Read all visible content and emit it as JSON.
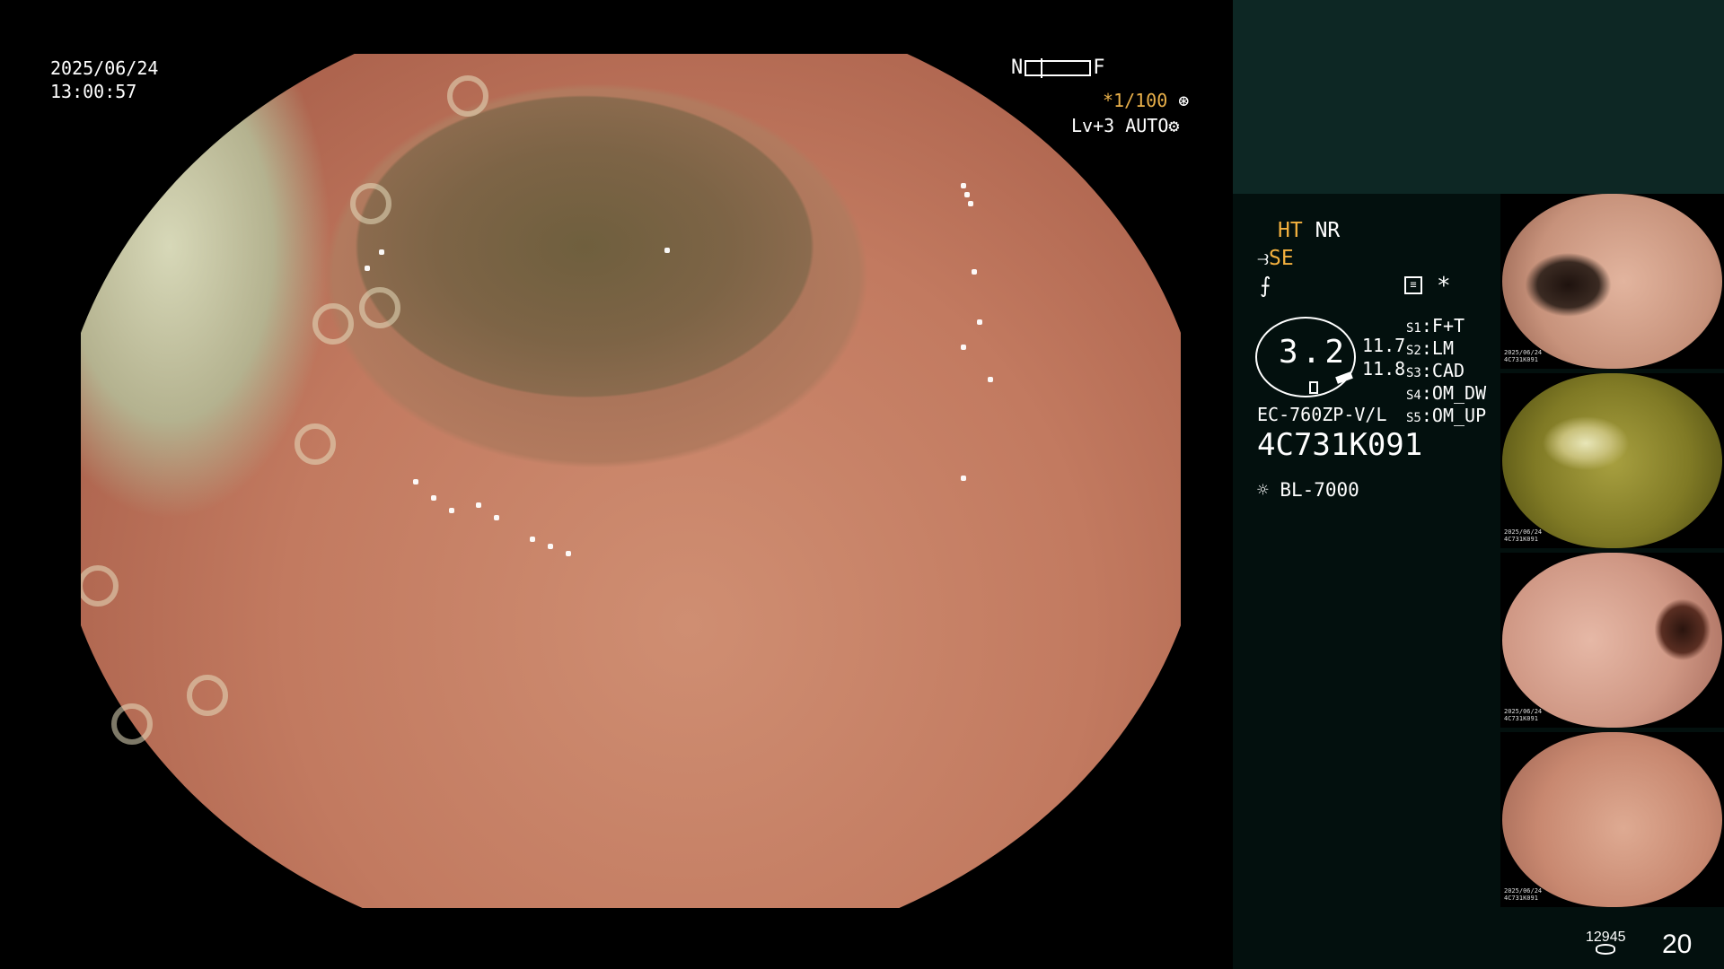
{
  "overlay": {
    "date": "2025/06/24",
    "time": "13:00:57",
    "near_label": "N",
    "far_label": "F",
    "zoom": "*1/100",
    "level": "Lv+3",
    "mode": "AUTO"
  },
  "panel": {
    "ht": "HT",
    "nr": "NR",
    "se": "SE",
    "star": "*",
    "gauge_value": "3.2",
    "value1": "11.7",
    "value2": "11.8",
    "settings": [
      {
        "key": "S1",
        "value": "F+T"
      },
      {
        "key": "S2",
        "value": "LM"
      },
      {
        "key": "S3",
        "value": "CAD"
      },
      {
        "key": "S4",
        "value": "OM_DW"
      },
      {
        "key": "S5",
        "value": "OM_UP"
      }
    ],
    "model": "EC-760ZP-V/L",
    "serial": "4C731K091",
    "lamp": "BL-7000",
    "image_count": "12945",
    "capture_number": "20"
  },
  "thumbnails": [
    {
      "label_date": "2025/06/24",
      "label_serial": "4C731K091"
    },
    {
      "label_date": "2025/06/24",
      "label_serial": "4C731K091"
    },
    {
      "label_date": "2025/06/24",
      "label_serial": "4C731K091"
    },
    {
      "label_date": "2025/06/24",
      "label_serial": "4C731K091"
    }
  ],
  "icons": {
    "zoom": "aperture-icon",
    "mode": "gear-icon",
    "se": "structure-enhance-icon",
    "fs": "filter-icon",
    "monitor": "monitor-icon",
    "lamp": "lamp-icon",
    "storage": "database-icon"
  }
}
